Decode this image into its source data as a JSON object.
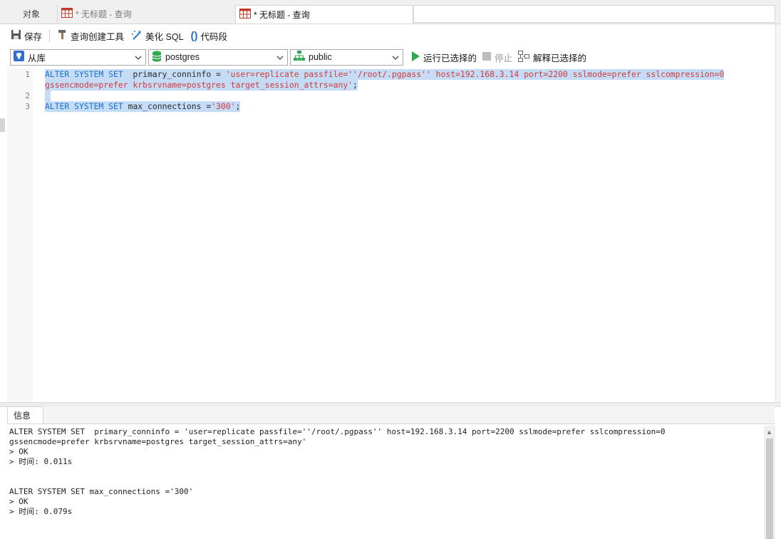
{
  "tabs": {
    "objects": "对象",
    "query1": "* 无标题 - 查询",
    "query2": "* 无标题 - 查询"
  },
  "toolbar": {
    "save": "保存",
    "query_builder": "查询创建工具",
    "beautify": "美化 SQL",
    "snippets": "代码段"
  },
  "selectors": {
    "connection": "从库",
    "database": "postgres",
    "schema": "public"
  },
  "actions": {
    "run_selected": "运行已选择的",
    "stop": "停止",
    "explain_selected": "解释已选择的"
  },
  "editor": {
    "line_numbers": [
      "1",
      "2",
      "3"
    ],
    "line1_kw": "ALTER SYSTEM SET",
    "line1_id": "  primary_conninfo = ",
    "line1_str": "'user=replicate passfile=''/root/.pgpass'' host=192.168.3.14 port=2200 sslmode=prefer sslcompression=0",
    "line1b_str": "gssencmode=prefer krbsrvname=postgres target_session_attrs=any'",
    "line1b_end": ";",
    "line3_kw": "ALTER SYSTEM SET",
    "line3_id": " max_connections =",
    "line3_str": "'300'",
    "line3_end": ";"
  },
  "info": {
    "tab_label": "信息",
    "lines": [
      "ALTER SYSTEM SET  primary_conninfo = 'user=replicate passfile=''/root/.pgpass'' host=192.168.3.14 port=2200 sslmode=prefer sslcompression=0",
      "gssencmode=prefer krbsrvname=postgres target_session_attrs=any'",
      "> OK",
      "> 时间: 0.011s",
      "ALTER SYSTEM SET max_connections ='300'",
      "> OK",
      "> 时间: 0.079s"
    ]
  },
  "colors": {
    "keyword": "#1d6fd0",
    "string": "#d23a3a",
    "selection": "#c5dcf6",
    "run_green": "#2fa84f"
  }
}
